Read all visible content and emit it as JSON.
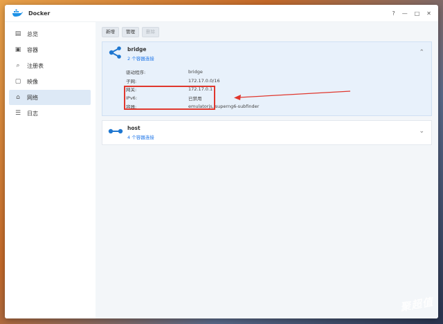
{
  "window": {
    "title": "Docker",
    "controls": [
      "?",
      "—",
      "□",
      "✕"
    ]
  },
  "sidebar": {
    "items": [
      {
        "label": "总览",
        "icon": "overview-icon",
        "glyph": "▤"
      },
      {
        "label": "容器",
        "icon": "container-icon",
        "glyph": "▣"
      },
      {
        "label": "注册表",
        "icon": "registry-icon",
        "glyph": "⌕"
      },
      {
        "label": "映像",
        "icon": "image-icon",
        "glyph": "▢"
      },
      {
        "label": "网络",
        "icon": "network-icon",
        "glyph": "⌂",
        "active": true
      },
      {
        "label": "日志",
        "icon": "log-icon",
        "glyph": "☰"
      }
    ]
  },
  "toolbar": {
    "add_label": "新增",
    "manage_label": "管理",
    "delete_label": "删除"
  },
  "networks": [
    {
      "name": "bridge",
      "connections": "2 个容器连接",
      "details": [
        {
          "key": "驱动程序:",
          "value": "bridge"
        },
        {
          "key": "子网:",
          "value": "172.17.0.0/16"
        },
        {
          "key": "网关:",
          "value": "172.17.0.1"
        },
        {
          "key": "IPv6:",
          "value": "已禁用"
        },
        {
          "key": "容器:",
          "value": "emulatorjs, superng6-subfinder"
        }
      ]
    },
    {
      "name": "host",
      "connections": "4 个容器连接"
    }
  ],
  "watermark": "聚超值",
  "colors": {
    "accent": "#1a73e8",
    "highlight": "#e0362c",
    "selected_bg": "#dde9f6"
  }
}
